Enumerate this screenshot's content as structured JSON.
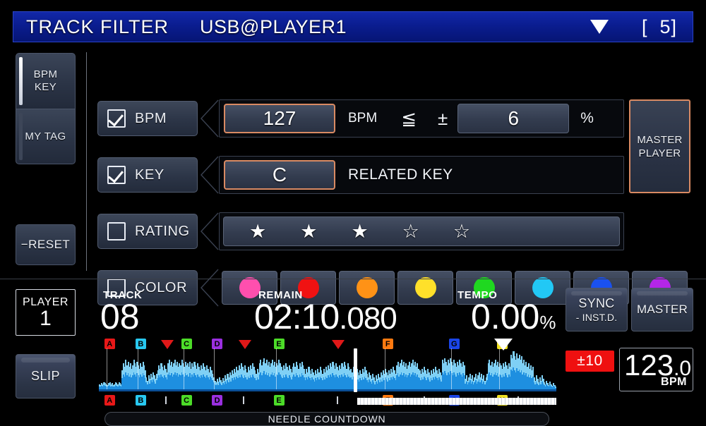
{
  "header": {
    "title": "TRACK FILTER",
    "source": "USB@PLAYER1",
    "filter_icon": "filter-triangle-icon",
    "count": "[  5]"
  },
  "sidebar": {
    "tabs": [
      {
        "label_line1": "BPM",
        "label_line2": "KEY",
        "selected": true
      },
      {
        "label_line1": "MY TAG",
        "label_line2": "",
        "selected": false
      }
    ],
    "reset_label": "−RESET"
  },
  "filters": {
    "bpm": {
      "checkbox_label": "BPM",
      "checked": true,
      "value": "127",
      "unit_label": "BPM",
      "operator": "≦",
      "plusminus": "±",
      "tolerance": "6",
      "tolerance_unit": "%"
    },
    "key": {
      "checkbox_label": "KEY",
      "checked": true,
      "value": "C",
      "mode_label": "RELATED KEY"
    },
    "rating": {
      "checkbox_label": "RATING",
      "checked": false,
      "filled": 3,
      "total": 5,
      "star_filled": "★",
      "star_empty": "☆"
    },
    "color": {
      "checkbox_label": "COLOR",
      "checked": false,
      "swatches": [
        {
          "name": "pink",
          "hex": "#ff4fae"
        },
        {
          "name": "red",
          "hex": "#f01212"
        },
        {
          "name": "orange",
          "hex": "#ff9216"
        },
        {
          "name": "yellow",
          "hex": "#ffe02a"
        },
        {
          "name": "green",
          "hex": "#1fd820"
        },
        {
          "name": "cyan",
          "hex": "#22c8f5"
        },
        {
          "name": "blue",
          "hex": "#1a51f0"
        },
        {
          "name": "purple",
          "hex": "#b426e8"
        }
      ]
    }
  },
  "master_player": {
    "line1": "MASTER",
    "line2": "PLAYER",
    "border_hex": "#d98a63"
  },
  "player": {
    "badge_label": "PLAYER",
    "badge_number": "1",
    "slip_label": "SLIP",
    "track_label": "TRACK",
    "track_value": "08",
    "remain_label": "REMAIN",
    "remain_minsec": "02:10",
    "remain_ms": ".080",
    "tempo_label": "TEMPO",
    "tempo_value": "0.00",
    "tempo_unit": "%",
    "sync_label": "SYNC",
    "sync_sub_label": "- INST.D.",
    "master_label": "MASTER",
    "tempo_range": "±10",
    "tempo_range_hex": "#ef1010",
    "bpm_value": "123",
    "bpm_decimal": ".0",
    "bpm_unit": "BPM",
    "needle_countdown_label": "NEEDLE COUNTDOWN",
    "playhead_pos_pct": 56.0
  },
  "waveform": {
    "cues": [
      {
        "letter": "A",
        "hex": "#e81818",
        "pos_pct": 1.2
      },
      {
        "letter": "B",
        "hex": "#28c8f0",
        "pos_pct": 8.0
      },
      {
        "letter": "C",
        "hex": "#4cdc28",
        "pos_pct": 18.0
      },
      {
        "letter": "D",
        "hex": "#9a2fe0",
        "pos_pct": 24.7
      },
      {
        "letter": "E",
        "hex": "#4cdc28",
        "pos_pct": 38.2
      },
      {
        "letter": "F",
        "hex": "#ff7a10",
        "pos_pct": 62.0
      },
      {
        "letter": "G",
        "hex": "#1a45e8",
        "pos_pct": 76.5
      },
      {
        "letter": "H",
        "hex": "#f0e020",
        "pos_pct": 87.0
      }
    ],
    "memory_markers_pct": [
      14.5,
      31.5,
      52.0,
      71.0,
      91.5
    ],
    "hot_cue_triangles_pct": [
      15.0,
      32.0,
      52.3
    ],
    "overview_ticks_pct": [
      14.5,
      31.5,
      52.0,
      71.0,
      91.5
    ],
    "color_body_hex": "#1e8fe0",
    "color_top_hex": "#7fd0f5",
    "baseline_hex": "#0a4f96",
    "bars": [
      6,
      5,
      7,
      6,
      8,
      7,
      6,
      5,
      7,
      8,
      6,
      7,
      5,
      6,
      8,
      7,
      6,
      8,
      7,
      6,
      22,
      30,
      26,
      34,
      28,
      32,
      26,
      30,
      24,
      28,
      34,
      30,
      26,
      32,
      28,
      24,
      30,
      26,
      32,
      28,
      22,
      14,
      10,
      16,
      12,
      18,
      14,
      20,
      16,
      12,
      18,
      22,
      28,
      24,
      30,
      26,
      22,
      28,
      24,
      20,
      30,
      34,
      28,
      32,
      26,
      30,
      34,
      28,
      32,
      26,
      30,
      28,
      34,
      30,
      26,
      32,
      28,
      30,
      26,
      32,
      24,
      30,
      26,
      32,
      28,
      24,
      30,
      26,
      22,
      28,
      24,
      30,
      26,
      22,
      28,
      24,
      20,
      26,
      22,
      18,
      14,
      10,
      8,
      12,
      9,
      14,
      11,
      8,
      13,
      10,
      16,
      12,
      18,
      14,
      20,
      16,
      22,
      18,
      24,
      20,
      26,
      22,
      28,
      24,
      30,
      26,
      22,
      28,
      24,
      20,
      26,
      22,
      28,
      24,
      30,
      26,
      22,
      18,
      24,
      20,
      30,
      34,
      28,
      32,
      36,
      30,
      34,
      28,
      32,
      26,
      30,
      34,
      28,
      32,
      26,
      30,
      28,
      34,
      30,
      26,
      22,
      28,
      24,
      30,
      26,
      22,
      28,
      24,
      20,
      26,
      30,
      26,
      32,
      28,
      24,
      30,
      26,
      32,
      28,
      24,
      18,
      24,
      20,
      26,
      22,
      18,
      24,
      20,
      16,
      22,
      18,
      24,
      20,
      26,
      22,
      18,
      24,
      20,
      26,
      22,
      28,
      24,
      30,
      26,
      32,
      28,
      24,
      30,
      26,
      22,
      28,
      24,
      30,
      26,
      32,
      28,
      24,
      30,
      26,
      22,
      24,
      20,
      26,
      22,
      18,
      24,
      20,
      16,
      22,
      18,
      24,
      20,
      26,
      22,
      18,
      14,
      20,
      16,
      12,
      18,
      14,
      10,
      16,
      12,
      18,
      14,
      20,
      16,
      22,
      18,
      24,
      20,
      16,
      22,
      18,
      24,
      20,
      26,
      22,
      18,
      28,
      32,
      26,
      30,
      34,
      28,
      32,
      26,
      30,
      24,
      28,
      32,
      26,
      30,
      34,
      28,
      32,
      26,
      30,
      24,
      22,
      18,
      24,
      20,
      26,
      22,
      18,
      24,
      20,
      16,
      22,
      18,
      24,
      20,
      26,
      22,
      18,
      24,
      20,
      16,
      34,
      30,
      36,
      32,
      28,
      34,
      30,
      36,
      32,
      28,
      34,
      30,
      26,
      32,
      28,
      34,
      30,
      26,
      32,
      28,
      12,
      16,
      10,
      14,
      18,
      12,
      16,
      10,
      14,
      18,
      12,
      16,
      20,
      14,
      18,
      12,
      16,
      10,
      14,
      18,
      30,
      34,
      28,
      32,
      26,
      30,
      34,
      28,
      32,
      26,
      30,
      28,
      24,
      30,
      26,
      32,
      28,
      24,
      30,
      26,
      40,
      36,
      44,
      38,
      34,
      42,
      36,
      40,
      34,
      38,
      30,
      34,
      28,
      32,
      26,
      30,
      24,
      28,
      22,
      26,
      14,
      10,
      16,
      12,
      8,
      14,
      10,
      16,
      12,
      8,
      6,
      10,
      7,
      5,
      9,
      6,
      4,
      7,
      5,
      3
    ]
  }
}
